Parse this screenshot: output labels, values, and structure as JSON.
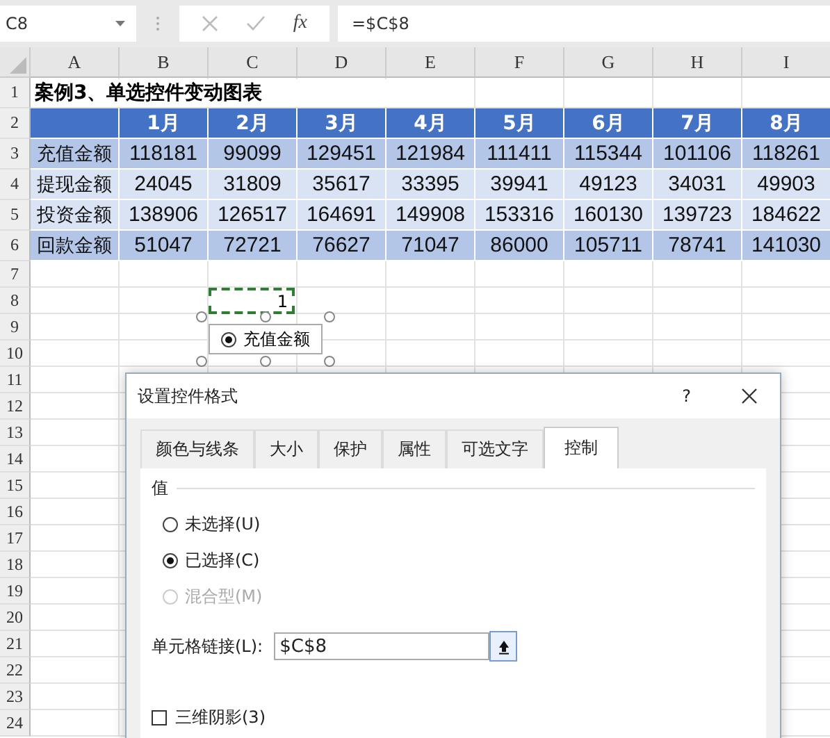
{
  "formula_bar": {
    "name_box": "C8",
    "function_label": "fx",
    "formula": "=$C$8"
  },
  "columns": [
    "A",
    "B",
    "C",
    "D",
    "E",
    "F",
    "G",
    "H",
    "I"
  ],
  "row_numbers": [
    "1",
    "2",
    "3",
    "4",
    "5",
    "6",
    "7",
    "8",
    "9",
    "10",
    "11",
    "12",
    "13",
    "14",
    "15",
    "16",
    "17",
    "18",
    "19",
    "20",
    "21",
    "22",
    "23",
    "24"
  ],
  "title": "案例3、单选控件变动图表",
  "table": {
    "header": [
      "1月",
      "2月",
      "3月",
      "4月",
      "5月",
      "6月",
      "7月",
      "8月"
    ],
    "rows": [
      {
        "label": "充值金额",
        "color": "#b4c6e7",
        "values": [
          "118181",
          "99099",
          "129451",
          "121984",
          "111411",
          "115344",
          "101106",
          "118261"
        ]
      },
      {
        "label": "提现金额",
        "color": "#dae3f3",
        "values": [
          "24045",
          "31809",
          "35617",
          "33395",
          "39941",
          "49123",
          "34031",
          "49903"
        ]
      },
      {
        "label": "投资金额",
        "color": "#dae3f3",
        "values": [
          "138906",
          "126517",
          "164691",
          "149908",
          "153316",
          "160130",
          "139723",
          "184622"
        ]
      },
      {
        "label": "回款金额",
        "color": "#b4c6e7",
        "values": [
          "51047",
          "72721",
          "76627",
          "71047",
          "86000",
          "105711",
          "78741",
          "141030"
        ]
      }
    ]
  },
  "linked_cell": {
    "value": "1"
  },
  "option_control": {
    "label": "充值金额",
    "selected": true
  },
  "dialog": {
    "title": "设置控件格式",
    "help": "?",
    "tabs": [
      {
        "label": "颜色与线条",
        "selected": false
      },
      {
        "label": "大小",
        "selected": false
      },
      {
        "label": "保护",
        "selected": false
      },
      {
        "label": "属性",
        "selected": false
      },
      {
        "label": "可选文字",
        "selected": false
      },
      {
        "label": "控制",
        "selected": true
      }
    ],
    "group_label": "值",
    "radios": [
      {
        "label": "未选择(U)",
        "selected": false,
        "disabled": false
      },
      {
        "label": "已选择(C)",
        "selected": true,
        "disabled": false
      },
      {
        "label": "混合型(M)",
        "selected": false,
        "disabled": true
      }
    ],
    "link_label": "单元格链接(L):",
    "link_value": "$C$8",
    "checkbox": {
      "label": "三维阴影(3)",
      "checked": false
    }
  }
}
